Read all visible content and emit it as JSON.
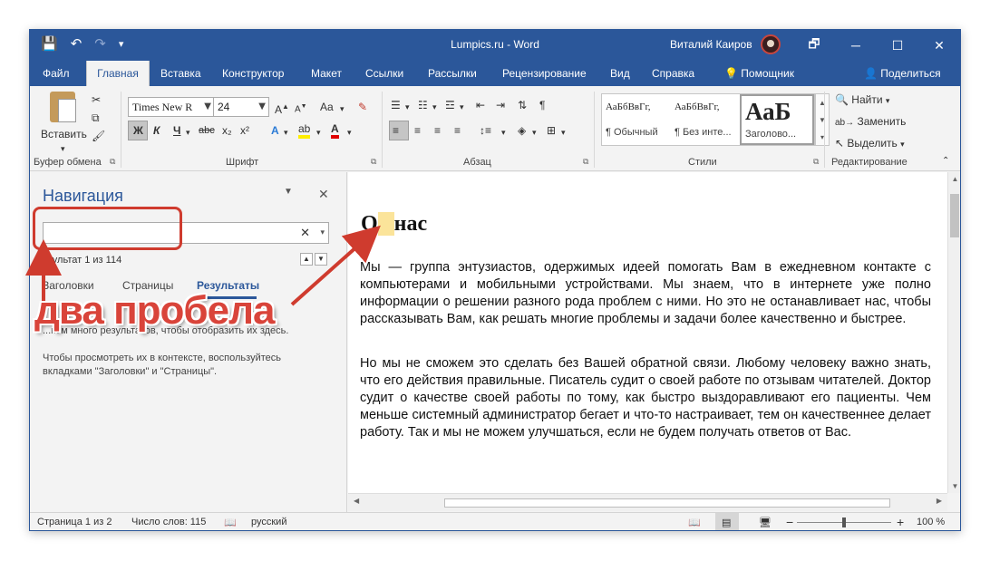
{
  "window": {
    "title": "Lumpics.ru  -  Word",
    "user": "Виталий Каиров",
    "qat": [
      "💾",
      "↶",
      "↷",
      "▾"
    ],
    "controls": [
      "🗗",
      "─",
      "☐",
      "✕"
    ]
  },
  "tabs": [
    "Файл",
    "Главная",
    "Вставка",
    "Конструктор",
    "Макет",
    "Ссылки",
    "Рассылки",
    "Рецензирование",
    "Вид",
    "Справка",
    "Помощник",
    "Поделиться"
  ],
  "ribbon": {
    "clipboard": {
      "paste": "Вставить",
      "label": "Буфер обмена"
    },
    "font": {
      "name": "Times New R",
      "size": "24",
      "label": "Шрифт",
      "aa": "Aa",
      "bold": "Ж",
      "italic": "К",
      "underline": "Ч",
      "strike": "abc",
      "sub": "x₂",
      "sup": "x²"
    },
    "paragraph": {
      "label": "Абзац",
      "pilcrow": "¶"
    },
    "styles": {
      "label": "Стили",
      "items": [
        {
          "sample": "АаБбВвГг,",
          "name": "¶ Обычный"
        },
        {
          "sample": "АаБбВвГг,",
          "name": "¶ Без инте..."
        },
        {
          "sample": "АаБ",
          "name": "Заголово..."
        }
      ]
    },
    "editing": {
      "find": "Найти",
      "replace": "Заменить",
      "select": "Выделить",
      "label": "Редактирование"
    }
  },
  "navigation": {
    "title": "Навигация",
    "result_count": "езультат 1 из 114",
    "tabs": [
      "Заголовки",
      "Страницы",
      "Результаты"
    ],
    "msg1": "...ком много результатов, чтобы отобразить их здесь.",
    "msg2": "Чтобы просмотреть их в контексте, воспользуйтесь вкладками \"Заголовки\" и \"Страницы\"."
  },
  "document": {
    "heading_parts": [
      "О",
      " ",
      "нас"
    ],
    "para1": "Мы — группа энтузиастов, одержимых идеей помогать Вам в ежедневном контакте с компьютерами и мобильными устройствами. Мы знаем, что в интернете уже полно информации о решении разного рода проблем с ними. Но это не останавливает нас, чтобы рассказывать Вам, как решать многие проблемы и задачи более качественно и быстрее.",
    "para2": "Но мы не сможем это сделать без Вашей обратной связи. Любому человеку важно знать, что его действия правильные. Писатель судит о своей работе по отзывам читателей. Доктор судит о качестве своей работы по тому, как быстро выздоравливают его пациенты. Чем меньше системный администратор бегает и что-то настраивает, тем он качественнее делает работу. Так и мы не можем улучшаться, если не будем получать ответов от Вас.",
    "highlight_color": "#fbe49a"
  },
  "status": {
    "page": "Страница 1 из 2",
    "words": "Число слов: 115",
    "lang": "русский",
    "zoom": "100 %",
    "zoom_level": 0.5
  },
  "annotation": {
    "label": "два пробела",
    "color": "#cf3b2e"
  }
}
